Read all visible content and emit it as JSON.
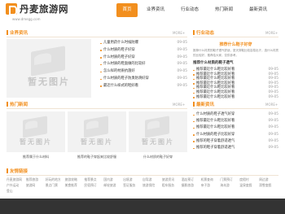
{
  "site": {
    "name": "丹麦旅游网",
    "url": "www.dmegg.com"
  },
  "nav": [
    "首页",
    "业界资讯",
    "行业动态",
    "热门新闻",
    "最新资讯"
  ],
  "more": "MORE+",
  "industry_news": {
    "title": "业界资讯",
    "image_text": "暂无图片",
    "items": [
      {
        "title": "儿童用药什么时候防爆",
        "date": "09-05"
      },
      {
        "title": "什么材质的鞋子好穿",
        "date": "09-05"
      },
      {
        "title": "什么材质的鞋子好穿",
        "date": "09-05"
      },
      {
        "title": "什么材质的鞋面做的比较好",
        "date": "09-05"
      },
      {
        "title": "怎么样的材质抗菌好",
        "date": "09-05"
      },
      {
        "title": "什么材质的鞋子防臭防滑好穿",
        "date": "09-05"
      },
      {
        "title": "最近什么样式的鞋好看",
        "date": "09-05"
      }
    ]
  },
  "industry_trends": {
    "title": "行业动态",
    "headline": "推荐什么鞋子好穿",
    "desc": "推荐什么材质的鞋子透气舒适，夏天穿鞋比较容易出汗，选什么材质的比较好，推荐给大家，仅供参考。",
    "sub": "推荐什么材质的鞋子透气",
    "items": [
      {
        "title": "推荐最近什么鞋比较好看",
        "date": "09-05"
      },
      {
        "title": "推荐最近什么鞋比较好看",
        "date": "09-05"
      },
      {
        "title": "推荐最近什么鞋比较好看",
        "date": "09-05"
      },
      {
        "title": "推荐最近什么鞋比较好看",
        "date": "09-05"
      },
      {
        "title": "推荐最近什么鞋比较好看",
        "date": "09-05"
      },
      {
        "title": "推荐最近什么鞋比较好看",
        "date": "09-05"
      },
      {
        "title": "推荐最近什么鞋比较好看",
        "date": "09-05"
      }
    ]
  },
  "hot_news": {
    "title": "热门新闻",
    "image_text": "暂无图片",
    "cards": [
      {
        "caption": "推荐属于什么材料"
      },
      {
        "caption": "推荐的鞋子穿起来比较舒服"
      },
      {
        "caption": "什么材质的鞋子好穿"
      }
    ]
  },
  "latest_news": {
    "title": "最新资讯",
    "items": [
      {
        "title": "什么材质的鞋子透气好穿",
        "date": "09-05"
      },
      {
        "title": "推荐最近什么鞋比较好看",
        "date": "09-05"
      },
      {
        "title": "推荐最近什么鞋比较好看",
        "date": "09-05"
      },
      {
        "title": "什么材质的鞋子比较好穿",
        "date": "09-05"
      },
      {
        "title": "推荐的鞋子穿着舒适透气",
        "date": "09-05"
      },
      {
        "title": "推荐的鞋子穿着舒适透气",
        "date": "09-05"
      }
    ]
  },
  "friend_links": {
    "title": "友情链接",
    "items": [
      "丹麦旅游网",
      "推荐旅游",
      "好玩的地方",
      "旅游攻略",
      "推荐景点",
      "国内游",
      "出境游",
      "自驾游",
      "旅游资讯",
      "酒店预订",
      "机票查询",
      "门票预订",
      "度假村",
      "周边游",
      "户外运动",
      "旅游网",
      "景点门票",
      "美食推荐",
      "民宿预订",
      "邮轮旅游",
      "签证服务",
      "旅游保险",
      "租车服务",
      "摄影旅游",
      "亲子游",
      "海岛游",
      "温泉度假",
      "滑雪度假",
      "登山"
    ]
  },
  "colors": {
    "accent": "#f28f1e",
    "footer": "#333333"
  }
}
